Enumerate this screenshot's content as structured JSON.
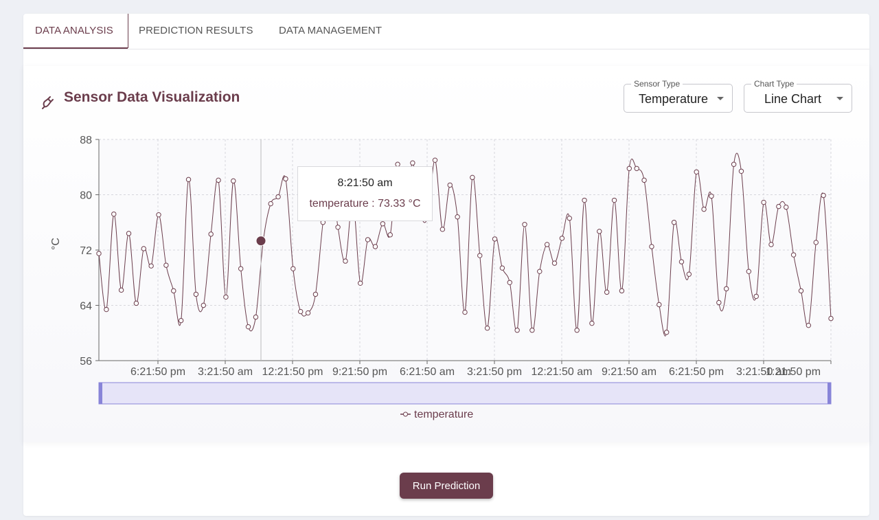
{
  "tabs": [
    {
      "label": "DATA ANALYSIS",
      "active": true
    },
    {
      "label": "PREDICTION RESULTS",
      "active": false
    },
    {
      "label": "DATA MANAGEMENT",
      "active": false
    }
  ],
  "panel": {
    "title": "Sensor Data Visualization",
    "title_icon": "sensor-plug-icon",
    "sensor_select": {
      "legend": "Sensor Type",
      "value": "Temperature"
    },
    "chart_select": {
      "legend": "Chart Type",
      "value": "Line Chart"
    }
  },
  "tooltip": {
    "time": "8:21:50 am",
    "text": "temperature : 73.33 °C"
  },
  "run_button": "Run Prediction",
  "colors": {
    "accent": "#6b3d4c",
    "brush": "#8884d8",
    "brush_fill": "#e6e4f8"
  },
  "chart_data": {
    "type": "line",
    "ylabel": "°C",
    "xlabel": "",
    "ylim": [
      56,
      88
    ],
    "yticks": [
      56,
      64,
      72,
      80,
      88
    ],
    "xtick_labels": [
      "6:21:50 pm",
      "3:21:50 am",
      "12:21:50 pm",
      "9:21:50 pm",
      "6:21:50 am",
      "3:21:50 pm",
      "12:21:50 am",
      "9:21:50 am",
      "6:21:50 pm",
      "3:21:50 am",
      "1:21:50 pm"
    ],
    "grid": true,
    "legend": "bottom-center",
    "series": [
      {
        "name": "temperature",
        "values": [
          71.5,
          63.4,
          77.2,
          66.2,
          74.4,
          64.3,
          72.2,
          69.7,
          77.1,
          69.8,
          66.1,
          61.8,
          82.2,
          65.6,
          64,
          74.3,
          82.1,
          65.2,
          82,
          69.3,
          60.9,
          62.3,
          73.3,
          78.7,
          79.7,
          82.3,
          69.3,
          63.1,
          62.9,
          65.6,
          76,
          83.1,
          75.3,
          70.4,
          79.3,
          67.2,
          73.5,
          72.5,
          75.8,
          74.2,
          84.4,
          77.8,
          84.6,
          77.3,
          76.7,
          85,
          75,
          81.4,
          76.8,
          63,
          82.5,
          71.2,
          60.7,
          73.6,
          69.4,
          67.3,
          60.4,
          75.7,
          60.4,
          68.9,
          72.8,
          70.1,
          73.7,
          76.6,
          60.4,
          79.2,
          61.4,
          74.7,
          65.9,
          79.2,
          66.1,
          83.8,
          83.8,
          82.1,
          72.5,
          64.1,
          60.1,
          76,
          70.3,
          68.5,
          83.3,
          77.9,
          79.8,
          64.4,
          66.4,
          84.4,
          83.4,
          68.9,
          65.3,
          78.9,
          72.8,
          78.3,
          78.2,
          71.3,
          66.1,
          61.1,
          73.1,
          79.9,
          62.1
        ],
        "highlight": {
          "time": "8:21:50 am",
          "value": 73.33
        }
      }
    ]
  }
}
